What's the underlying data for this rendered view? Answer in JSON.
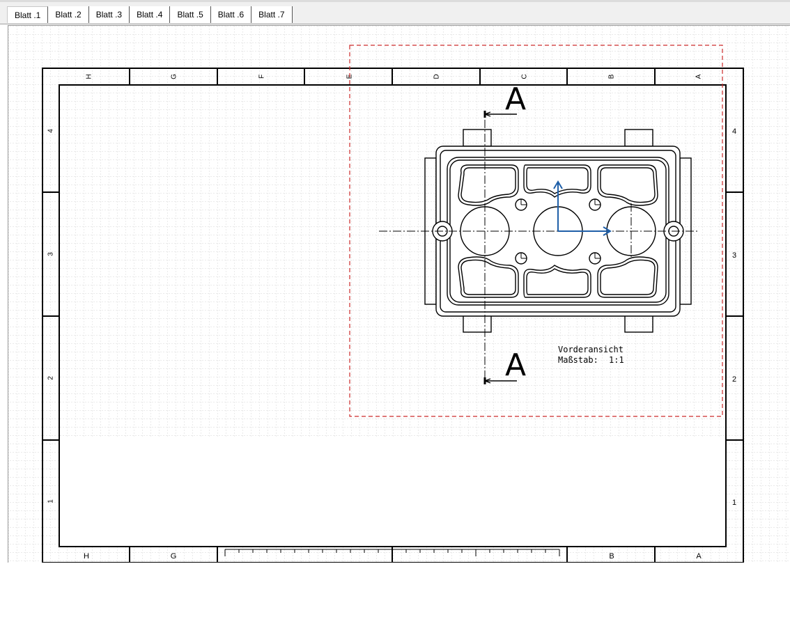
{
  "tabs": [
    "Blatt .1",
    "Blatt .2",
    "Blatt .3",
    "Blatt .4",
    "Blatt .5",
    "Blatt .6",
    "Blatt .7"
  ],
  "sheet": {
    "column_labels_top": [
      "H",
      "G",
      "F",
      "E",
      "D",
      "C",
      "B",
      "A"
    ],
    "column_labels_bottom": [
      "H",
      "G",
      "B",
      "A"
    ],
    "row_labels": [
      "4",
      "3",
      "2",
      "1"
    ]
  },
  "view": {
    "title": "Vorderansicht",
    "scale_label": "Maßstab:",
    "scale_value": "1:1",
    "section_marker_top": "A",
    "section_marker_bottom": "A"
  },
  "colors": {
    "view_frame": "#cc2a2a",
    "axis": "#1f5fa8",
    "grid": "#d4d4d4",
    "lines": "#000000"
  }
}
